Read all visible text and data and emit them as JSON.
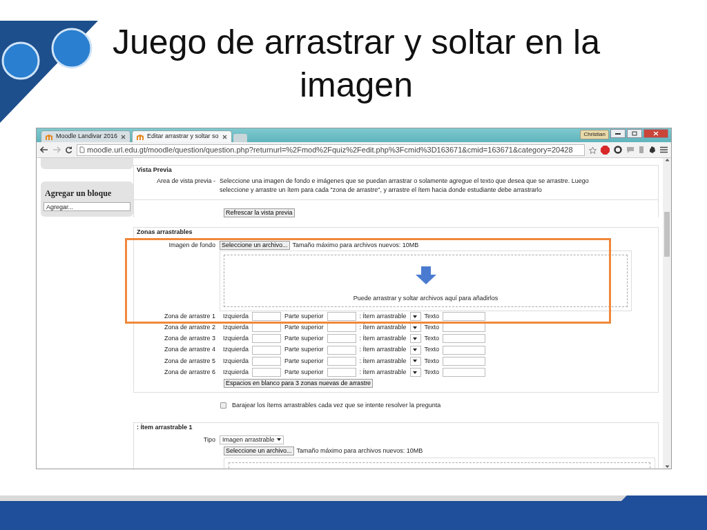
{
  "slide": {
    "title": "Juego de arrastrar y soltar en la imagen"
  },
  "browser": {
    "tabs": [
      {
        "label": "Moodle Landivar 2016",
        "selected": false
      },
      {
        "label": "Editar arrastrar y soltar so",
        "selected": true
      }
    ],
    "user": "Christian",
    "url": "moodle.url.edu.gt/moodle/question/question.php?returnurl=%2Fmod%2Fquiz%2Fedit.php%3Fcmid%3D163671&cmid=163671&category=20428"
  },
  "sidebar": {
    "block_title": "Agregar un bloque",
    "select": "Agregar..."
  },
  "preview": {
    "legend": "Vista Previa",
    "label": "Area de vista previa -",
    "text": "Seleccione una imagen de fondo e imágenes que se puedan arrastrar o solamente agregue el texto que desea que se arrastre. Luego seleccione y arrastre un ítem para cada \"zona de arrastre\", y arrastre el ítem hacia donde estudiante debe arrastrarlo",
    "refresh_button": "Refrescar la vista previa"
  },
  "zones": {
    "legend": "Zonas arrastrables",
    "highlighted": true,
    "background_label": "Imagen de fondo",
    "file_button": "Seleccione un archivo...",
    "max_size": "Tamaño máximo para archivos nuevos: 10MB",
    "drop_hint": "Puede arrastrar y soltar archivos aquí para añadirlos",
    "rows": [
      {
        "label": "Zona de arrastre 1",
        "left": "Izquierda",
        "top": "Parte superior",
        "item": ": Ítem arrastrable",
        "text": "Texto"
      },
      {
        "label": "Zona de arrastre 2",
        "left": "Izquierda",
        "top": "Parte superior",
        "item": ": Ítem arrastrable",
        "text": "Texto"
      },
      {
        "label": "Zona de arrastre 3",
        "left": "Izquierda",
        "top": "Parte superior",
        "item": ": Ítem arrastrable",
        "text": "Texto"
      },
      {
        "label": "Zona de arrastre 4",
        "left": "Izquierda",
        "top": "Parte superior",
        "item": ": Ítem arrastrable",
        "text": "Texto"
      },
      {
        "label": "Zona de arrastre 5",
        "left": "Izquierda",
        "top": "Parte superior",
        "item": ": Ítem arrastrable",
        "text": "Texto"
      },
      {
        "label": "Zona de arrastre 6",
        "left": "Izquierda",
        "top": "Parte superior",
        "item": ": Ítem arrastrable",
        "text": "Texto"
      }
    ],
    "add_button": "Espacios en blanco para 3 zonas nuevas de arrastre"
  },
  "shuffle": {
    "label": "Barajear los ítems arrastrables cada vez que se intente resolver la pregunta",
    "checked": false
  },
  "drag_item": {
    "legend": ": Ítem arrastrable 1",
    "type_label": "Tipo",
    "type_value": "Imagen arrastrable",
    "file_button": "Seleccione un archivo...",
    "max_size": "Tamaño máximo para archivos nuevos: 10MB"
  }
}
